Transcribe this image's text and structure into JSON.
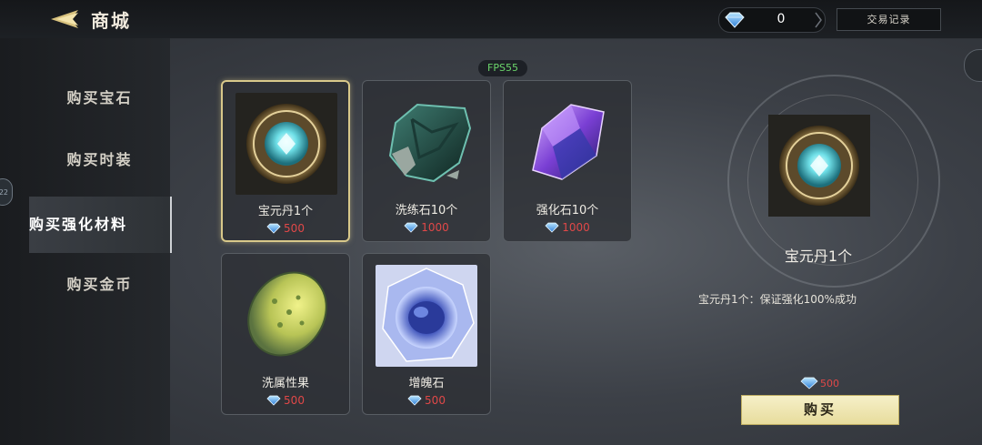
{
  "header": {
    "title": "商城",
    "currency_value": "0",
    "trade_record_label": "交易记录"
  },
  "sidebar": {
    "items": [
      {
        "label": "购买宝石"
      },
      {
        "label": "购买时装"
      },
      {
        "label": "购买强化材料"
      },
      {
        "label": "购买金币"
      }
    ],
    "active_index": 2
  },
  "fps": "FPS55",
  "shop": {
    "items": [
      {
        "name": "宝元丹1个",
        "price": "500",
        "icon": "ornate-gem-orb"
      },
      {
        "name": "洗练石10个",
        "price": "1000",
        "icon": "dark-green-stone"
      },
      {
        "name": "强化石10个",
        "price": "1000",
        "icon": "purple-crystal"
      },
      {
        "name": "洗属性果",
        "price": "500",
        "icon": "yellow-green-fruit"
      },
      {
        "name": "增魄石",
        "price": "500",
        "icon": "blue-crystal-stone"
      }
    ],
    "selected_index": 0
  },
  "detail": {
    "name": "宝元丹1个",
    "description": "宝元丹1个：保证强化100%成功",
    "price": "500",
    "buy_label": "购买"
  },
  "colors": {
    "price_red": "#e04848",
    "buy_button": "#f2ebbb",
    "selected_border": "#d8c88a",
    "fps_green": "#6bd56b"
  }
}
